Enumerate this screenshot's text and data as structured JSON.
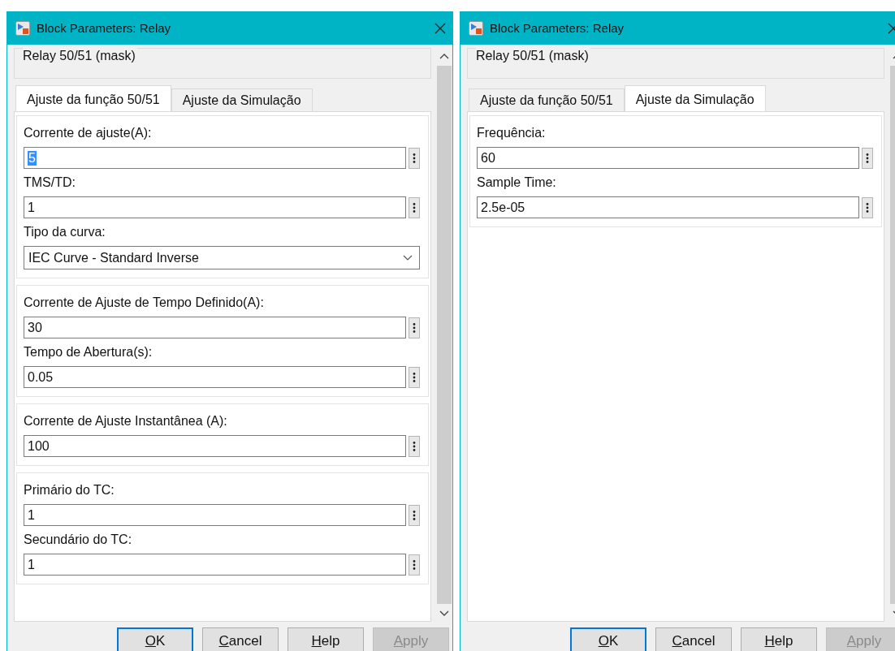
{
  "windows": [
    {
      "title": "Block Parameters: Relay",
      "description": "Relay 50/51 (mask)",
      "tabs": [
        {
          "label": "Ajuste da função 50/51",
          "selected": true
        },
        {
          "label": "Ajuste da Simulação",
          "selected": false
        }
      ],
      "groups": [
        {
          "params": [
            {
              "kind": "edit",
              "label": "Corrente de ajuste(A):",
              "value": "5",
              "selected": true
            },
            {
              "kind": "edit",
              "label": "TMS/TD:",
              "value": "1",
              "selected": false
            },
            {
              "kind": "popup",
              "label": "Tipo da curva:",
              "value": "IEC Curve - Standard Inverse",
              "selected": false
            }
          ]
        },
        {
          "params": [
            {
              "kind": "edit",
              "label": "Corrente de Ajuste de Tempo Definido(A):",
              "value": "30",
              "selected": false
            },
            {
              "kind": "edit",
              "label": "Tempo de Abertura(s):",
              "value": "0.05",
              "selected": false
            }
          ]
        },
        {
          "params": [
            {
              "kind": "edit",
              "label": "Corrente de Ajuste Instantânea (A):",
              "value": "100",
              "selected": false
            }
          ]
        },
        {
          "params": [
            {
              "kind": "edit",
              "label": "Primário do TC:",
              "value": "1",
              "selected": false
            },
            {
              "kind": "edit",
              "label": "Secundário do TC:",
              "value": "1",
              "selected": false
            }
          ]
        }
      ],
      "buttons": [
        {
          "label": "OK",
          "underline_first": true,
          "default": true,
          "disabled": false
        },
        {
          "label": "Cancel",
          "underline_first": true,
          "default": false,
          "disabled": false
        },
        {
          "label": "Help",
          "underline_first": true,
          "default": false,
          "disabled": false
        },
        {
          "label": "Apply",
          "underline_first": true,
          "default": false,
          "disabled": true
        }
      ]
    },
    {
      "title": "Block Parameters: Relay",
      "description": "Relay 50/51 (mask)",
      "tabs": [
        {
          "label": "Ajuste da função 50/51",
          "selected": false
        },
        {
          "label": "Ajuste da Simulação",
          "selected": true
        }
      ],
      "groups": [
        {
          "params": [
            {
              "kind": "edit",
              "label": "Frequência:",
              "value": "60",
              "selected": false
            },
            {
              "kind": "edit",
              "label": "Sample Time:",
              "value": "2.5e-05",
              "selected": false
            }
          ]
        }
      ],
      "buttons": [
        {
          "label": "OK",
          "underline_first": true,
          "default": true,
          "disabled": false
        },
        {
          "label": "Cancel",
          "underline_first": true,
          "default": false,
          "disabled": false
        },
        {
          "label": "Help",
          "underline_first": true,
          "default": false,
          "disabled": false
        },
        {
          "label": "Apply",
          "underline_first": true,
          "default": false,
          "disabled": true
        }
      ]
    }
  ]
}
